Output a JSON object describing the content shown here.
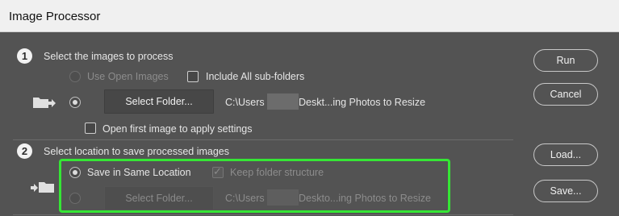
{
  "window": {
    "title": "Image Processor"
  },
  "section1": {
    "number": "1",
    "heading": "Select the images to process",
    "use_open_images": "Use Open Images",
    "include_subfolders": "Include All sub-folders",
    "select_folder_button": "Select Folder...",
    "path_prefix": "C:\\Users",
    "path_suffix": "Deskt...ing Photos to Resize",
    "open_first_image": "Open first image to apply settings"
  },
  "section2": {
    "number": "2",
    "heading": "Select location to save processed images",
    "save_same_location": "Save in Same Location",
    "keep_folder_structure": "Keep folder structure",
    "select_folder_button": "Select Folder...",
    "path_prefix": "C:\\Users",
    "path_suffix": "Deskto...ing Photos to Resize"
  },
  "buttons": {
    "run": "Run",
    "cancel": "Cancel",
    "load": "Load...",
    "save": "Save..."
  },
  "colors": {
    "dialog_bg": "#535353",
    "highlight": "#35e635"
  }
}
